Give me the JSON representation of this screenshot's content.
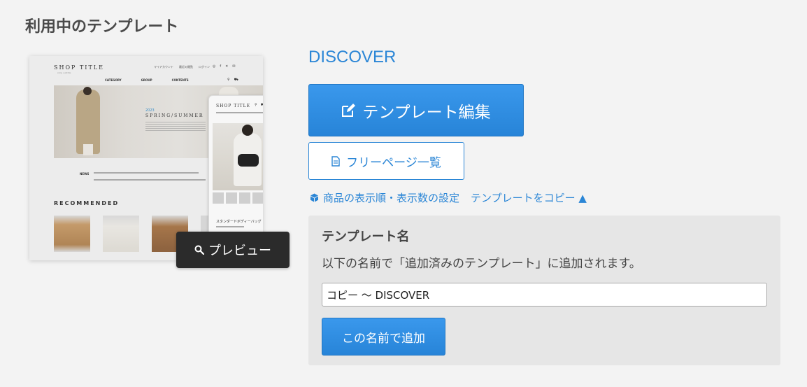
{
  "page": {
    "title": "利用中のテンプレート"
  },
  "thumbnail": {
    "shop_title": "SHOP TITLE",
    "shop_subtitle": "shop subtitle",
    "top_nav": [
      "マイアカウント",
      "最近の閲覧",
      "ログイン"
    ],
    "category_nav": [
      "CATEGORY",
      "GROUP",
      "CONTENTS"
    ],
    "hero_year": "2023",
    "hero_season": "SPRING/SUMMER",
    "news_label": "NEWS",
    "recommended": "RECOMMENDED",
    "mobile_shop_title": "SHOP TITLE",
    "mobile_product_title": "スタンダードボディーバッグ"
  },
  "preview_button": {
    "label": "プレビュー",
    "icon": "search-icon"
  },
  "template": {
    "name": "DISCOVER"
  },
  "actions": {
    "edit_label": "テンプレート編集",
    "edit_icon": "edit-icon",
    "free_pages_label": "フリーページ一覧",
    "free_pages_icon": "document-icon",
    "sort_settings_label": "商品の表示順・表示数の設定",
    "sort_settings_icon": "cube-icon",
    "copy_label": "テンプレートをコピー ▲"
  },
  "copy_panel": {
    "title": "テンプレート名",
    "description": "以下の名前で「追加済みのテンプレート」に追加されます。",
    "input_value": "コピー ～ DISCOVER",
    "submit_label": "この名前で追加"
  },
  "colors": {
    "accent": "#2b86d6",
    "button": "#2784d8",
    "panel": "#e6e6e6",
    "preview_button": "#2b2b2b"
  }
}
